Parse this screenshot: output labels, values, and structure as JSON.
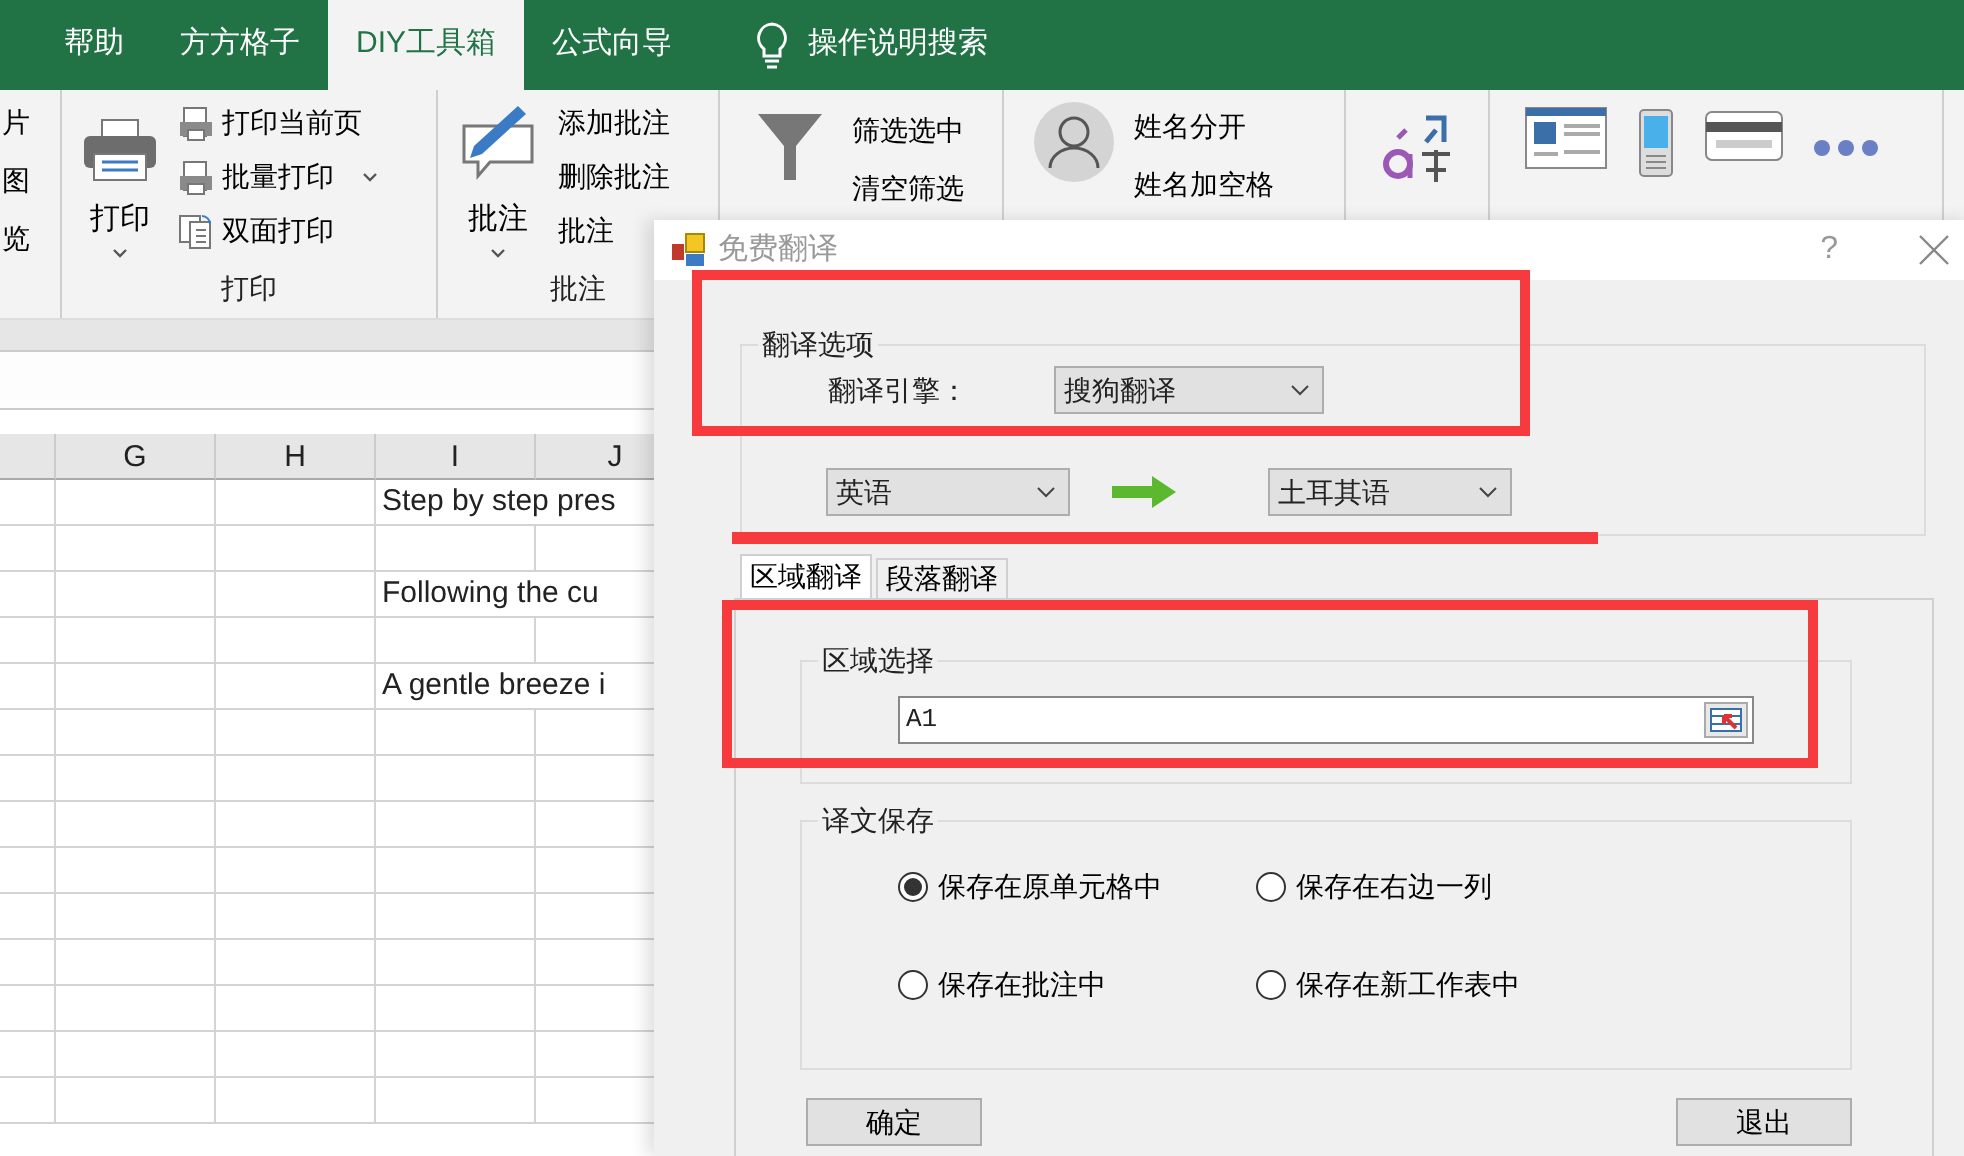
{
  "ribbon_tabs": [
    {
      "label": "帮助",
      "selected": false
    },
    {
      "label": "方方格子",
      "selected": false
    },
    {
      "label": "DIY工具箱",
      "selected": true
    },
    {
      "label": "公式向导",
      "selected": false
    },
    {
      "label": "操作说明搜索",
      "selected": false,
      "kind": "search"
    }
  ],
  "ribbon_edge_items": [
    "片",
    "图",
    "览"
  ],
  "print_group": {
    "large_button": "打印",
    "items": [
      {
        "label": "打印当前页",
        "dropdown": false
      },
      {
        "label": "批量打印",
        "dropdown": true
      },
      {
        "label": "双面打印",
        "dropdown": false
      }
    ],
    "title": "打印"
  },
  "comment_group": {
    "large_button": "批注",
    "items": [
      "添加批注",
      "删除批注",
      "批注"
    ],
    "title": "批注"
  },
  "filter_group": {
    "items": [
      "筛选选中",
      "清空筛选"
    ]
  },
  "name_group": {
    "items": [
      "姓名分开",
      "姓名加空格"
    ]
  },
  "sheet": {
    "columns": [
      "G",
      "H",
      "I",
      "J"
    ],
    "texts": [
      "Step by step pres",
      "Following the cu",
      "A gentle breeze i"
    ]
  },
  "dialog": {
    "title": "免费翻译",
    "help": "?",
    "options_group": {
      "title": "翻译选项",
      "engine_label": "翻译引擎：",
      "engine": "搜狗翻译",
      "source_language": "英语",
      "target_language": "土耳其语"
    },
    "tabs": [
      {
        "label": "区域翻译",
        "selected": true
      },
      {
        "label": "段落翻译",
        "selected": false
      }
    ],
    "range_group": {
      "title": "区域选择",
      "value": "A1"
    },
    "save_group": {
      "title": "译文保存",
      "options": [
        {
          "label": "保存在原单元格中",
          "selected": true
        },
        {
          "label": "保存在右边一列",
          "selected": false
        },
        {
          "label": "保存在批注中",
          "selected": false
        },
        {
          "label": "保存在新工作表中",
          "selected": false
        }
      ]
    },
    "buttons": [
      "确定",
      "退出"
    ]
  }
}
